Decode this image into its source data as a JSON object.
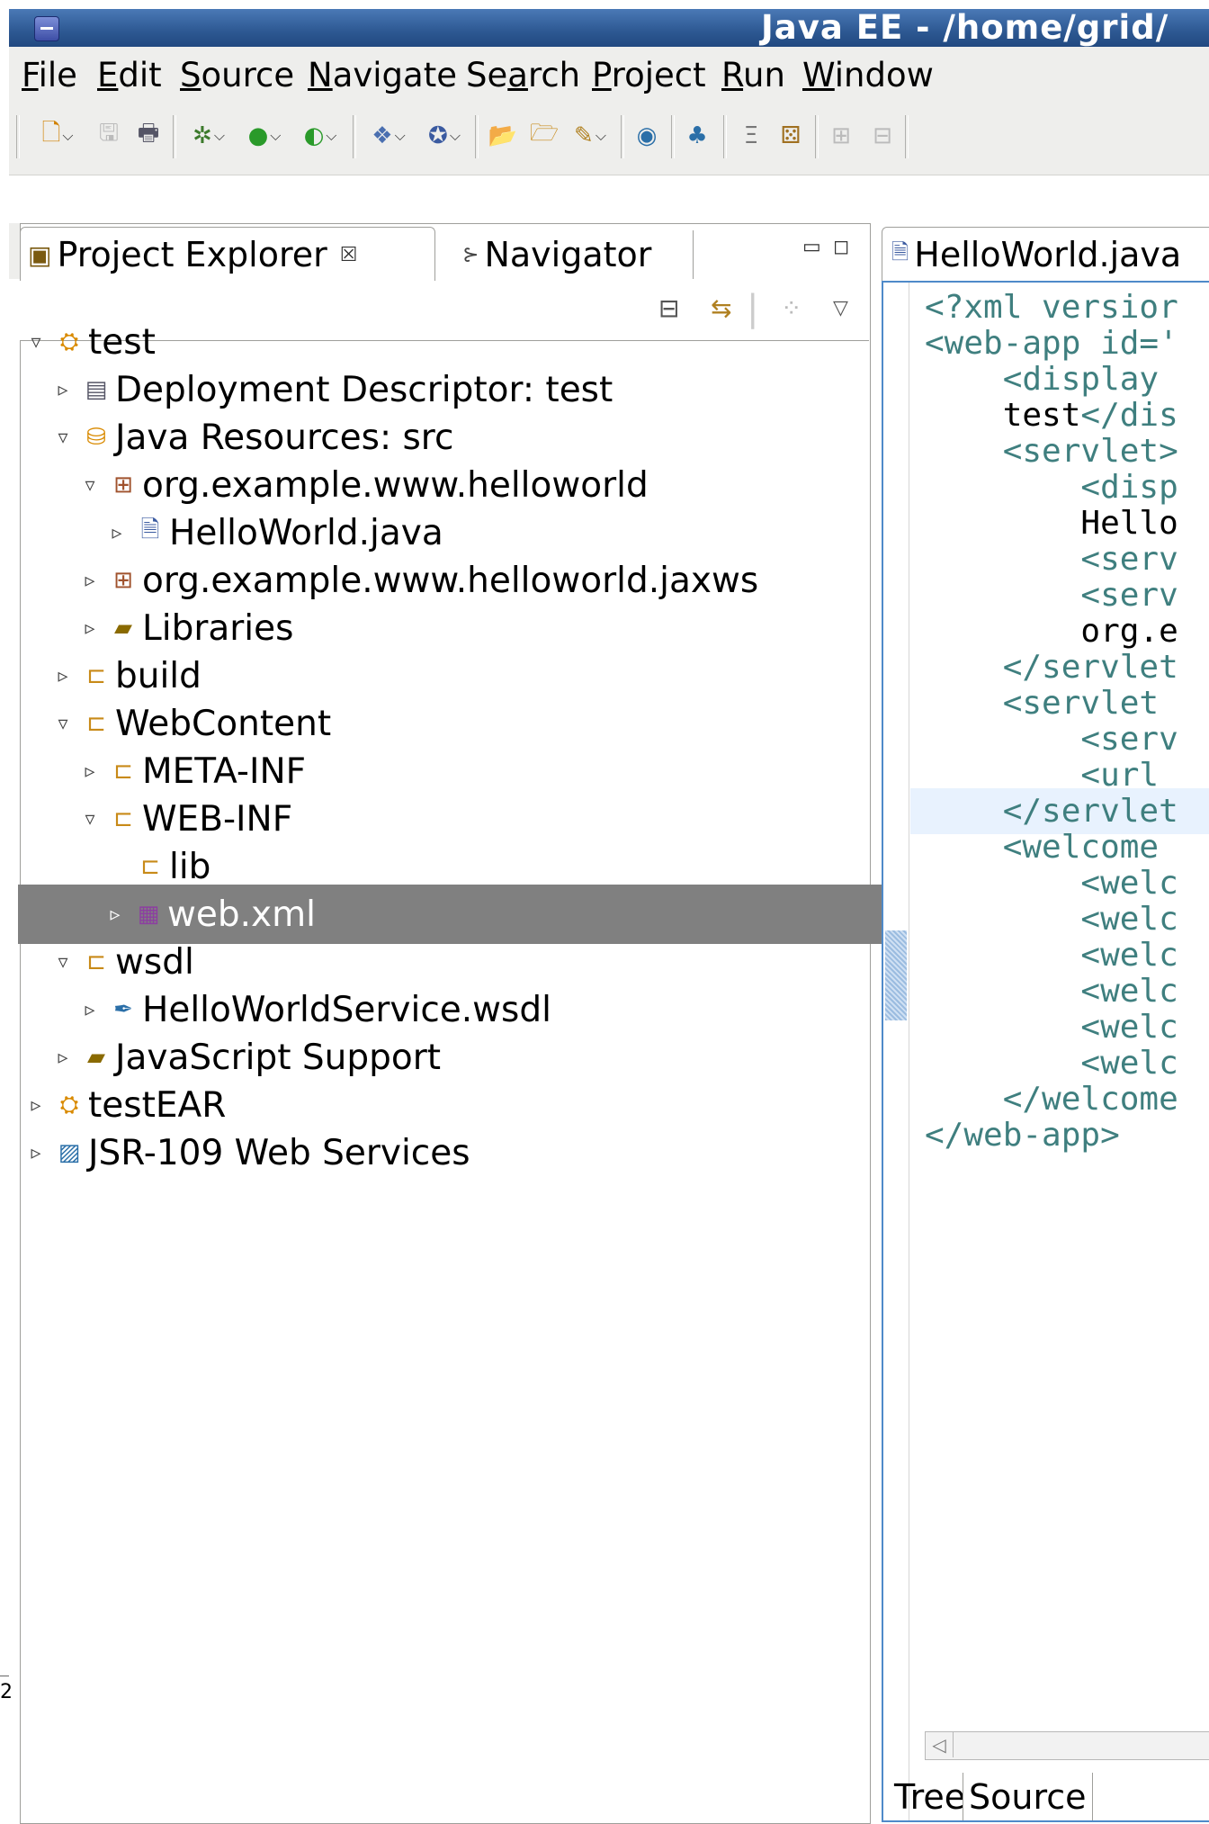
{
  "window": {
    "title": "Java EE - /home/grid/"
  },
  "menu": [
    {
      "pre": "",
      "u": "F",
      "post": "ile"
    },
    {
      "pre": "",
      "u": "E",
      "post": "dit"
    },
    {
      "pre": "",
      "u": "S",
      "post": "ource"
    },
    {
      "pre": "",
      "u": "N",
      "post": "avigate"
    },
    {
      "pre": "Se",
      "u": "a",
      "post": "rch"
    },
    {
      "pre": "",
      "u": "P",
      "post": "roject"
    },
    {
      "pre": "",
      "u": "R",
      "post": "un"
    },
    {
      "pre": "",
      "u": "W",
      "post": "indow"
    }
  ],
  "left_view": {
    "tabs": {
      "active": "Project Explorer",
      "inactive": "Navigator",
      "close_glyph": "☒"
    },
    "tree": [
      {
        "label": "test",
        "icon": "project-icon",
        "twisty": "▿",
        "selected": false
      },
      {
        "label": "Deployment Descriptor: test",
        "icon": "deployment-descriptor-icon",
        "twisty": "▹",
        "selected": false
      },
      {
        "label": "Java Resources: src",
        "icon": "java-resources-icon",
        "twisty": "▿",
        "selected": false
      },
      {
        "label": "org.example.www.helloworld",
        "icon": "package-icon",
        "twisty": "▿",
        "selected": false
      },
      {
        "label": "HelloWorld.java",
        "icon": "java-file-icon",
        "twisty": "▹",
        "selected": false
      },
      {
        "label": "org.example.www.helloworld.jaxws",
        "icon": "package-icon",
        "twisty": "▹",
        "selected": false
      },
      {
        "label": "Libraries",
        "icon": "libraries-icon",
        "twisty": "▹",
        "selected": false
      },
      {
        "label": "build",
        "icon": "folder-icon",
        "twisty": "▹",
        "selected": false
      },
      {
        "label": "WebContent",
        "icon": "folder-icon",
        "twisty": "▿",
        "selected": false
      },
      {
        "label": "META-INF",
        "icon": "folder-icon",
        "twisty": "▹",
        "selected": false
      },
      {
        "label": "WEB-INF",
        "icon": "folder-icon",
        "twisty": "▿",
        "selected": false
      },
      {
        "label": "lib",
        "icon": "folder-icon",
        "twisty": "",
        "selected": false
      },
      {
        "label": "web.xml",
        "icon": "xml-file-icon",
        "twisty": "▹",
        "selected": true
      },
      {
        "label": "wsdl",
        "icon": "folder-icon",
        "twisty": "▿",
        "selected": false
      },
      {
        "label": "HelloWorldService.wsdl",
        "icon": "wsdl-file-icon",
        "twisty": "▹",
        "selected": false
      },
      {
        "label": "JavaScript Support",
        "icon": "libraries-icon",
        "twisty": "▹",
        "selected": false
      },
      {
        "label": "testEAR",
        "icon": "ear-project-icon",
        "twisty": "▹",
        "selected": false
      },
      {
        "label": "JSR-109 Web Services",
        "icon": "web-services-icon",
        "twisty": "▹",
        "selected": false
      }
    ]
  },
  "editor": {
    "tab_label": "HelloWorld.java",
    "lines": [
      {
        "text": "<?xml versior",
        "kind": "tag",
        "highlight": false
      },
      {
        "text": "<web-app id='",
        "kind": "tag",
        "highlight": false
      },
      {
        "text": "    <display",
        "kind": "tag",
        "highlight": false
      },
      {
        "text": "    test</dis",
        "kind": "mixed",
        "plain": "    test",
        "tag": "</dis",
        "highlight": false
      },
      {
        "text": "    <servlet>",
        "kind": "tag",
        "highlight": false
      },
      {
        "text": "        <disp",
        "kind": "tag",
        "highlight": false
      },
      {
        "text": "        Hello",
        "kind": "text",
        "highlight": false
      },
      {
        "text": "        <serv",
        "kind": "tag",
        "highlight": false
      },
      {
        "text": "        <serv",
        "kind": "tag",
        "highlight": false
      },
      {
        "text": "        org.e",
        "kind": "text",
        "highlight": false
      },
      {
        "text": "    </servlet",
        "kind": "tag",
        "highlight": false
      },
      {
        "text": "    <servlet ",
        "kind": "tag",
        "highlight": false
      },
      {
        "text": "        <serv",
        "kind": "tag",
        "highlight": false
      },
      {
        "text": "        <url ",
        "kind": "tag",
        "highlight": false
      },
      {
        "text": "    </servlet",
        "kind": "tag",
        "highlight": true
      },
      {
        "text": "    <welcome ",
        "kind": "tag",
        "highlight": false
      },
      {
        "text": "        <welc",
        "kind": "tag",
        "highlight": false
      },
      {
        "text": "        <welc",
        "kind": "tag",
        "highlight": false
      },
      {
        "text": "        <welc",
        "kind": "tag",
        "highlight": false
      },
      {
        "text": "        <welc",
        "kind": "tag",
        "highlight": false
      },
      {
        "text": "        <welc",
        "kind": "tag",
        "highlight": false
      },
      {
        "text": "        <welc",
        "kind": "tag",
        "highlight": false
      },
      {
        "text": "    </welcome",
        "kind": "tag",
        "highlight": false
      },
      {
        "text": "</web-app>",
        "kind": "tag",
        "highlight": false
      }
    ],
    "bottom_tabs": [
      "Tree",
      "Source"
    ],
    "active_bottom_tab": "Source"
  },
  "desktop": {
    "edge_text": "2"
  },
  "colors": {
    "selection": "#808080",
    "xml_tag": "#3f7f7f",
    "title_bar": "#2d5892"
  }
}
